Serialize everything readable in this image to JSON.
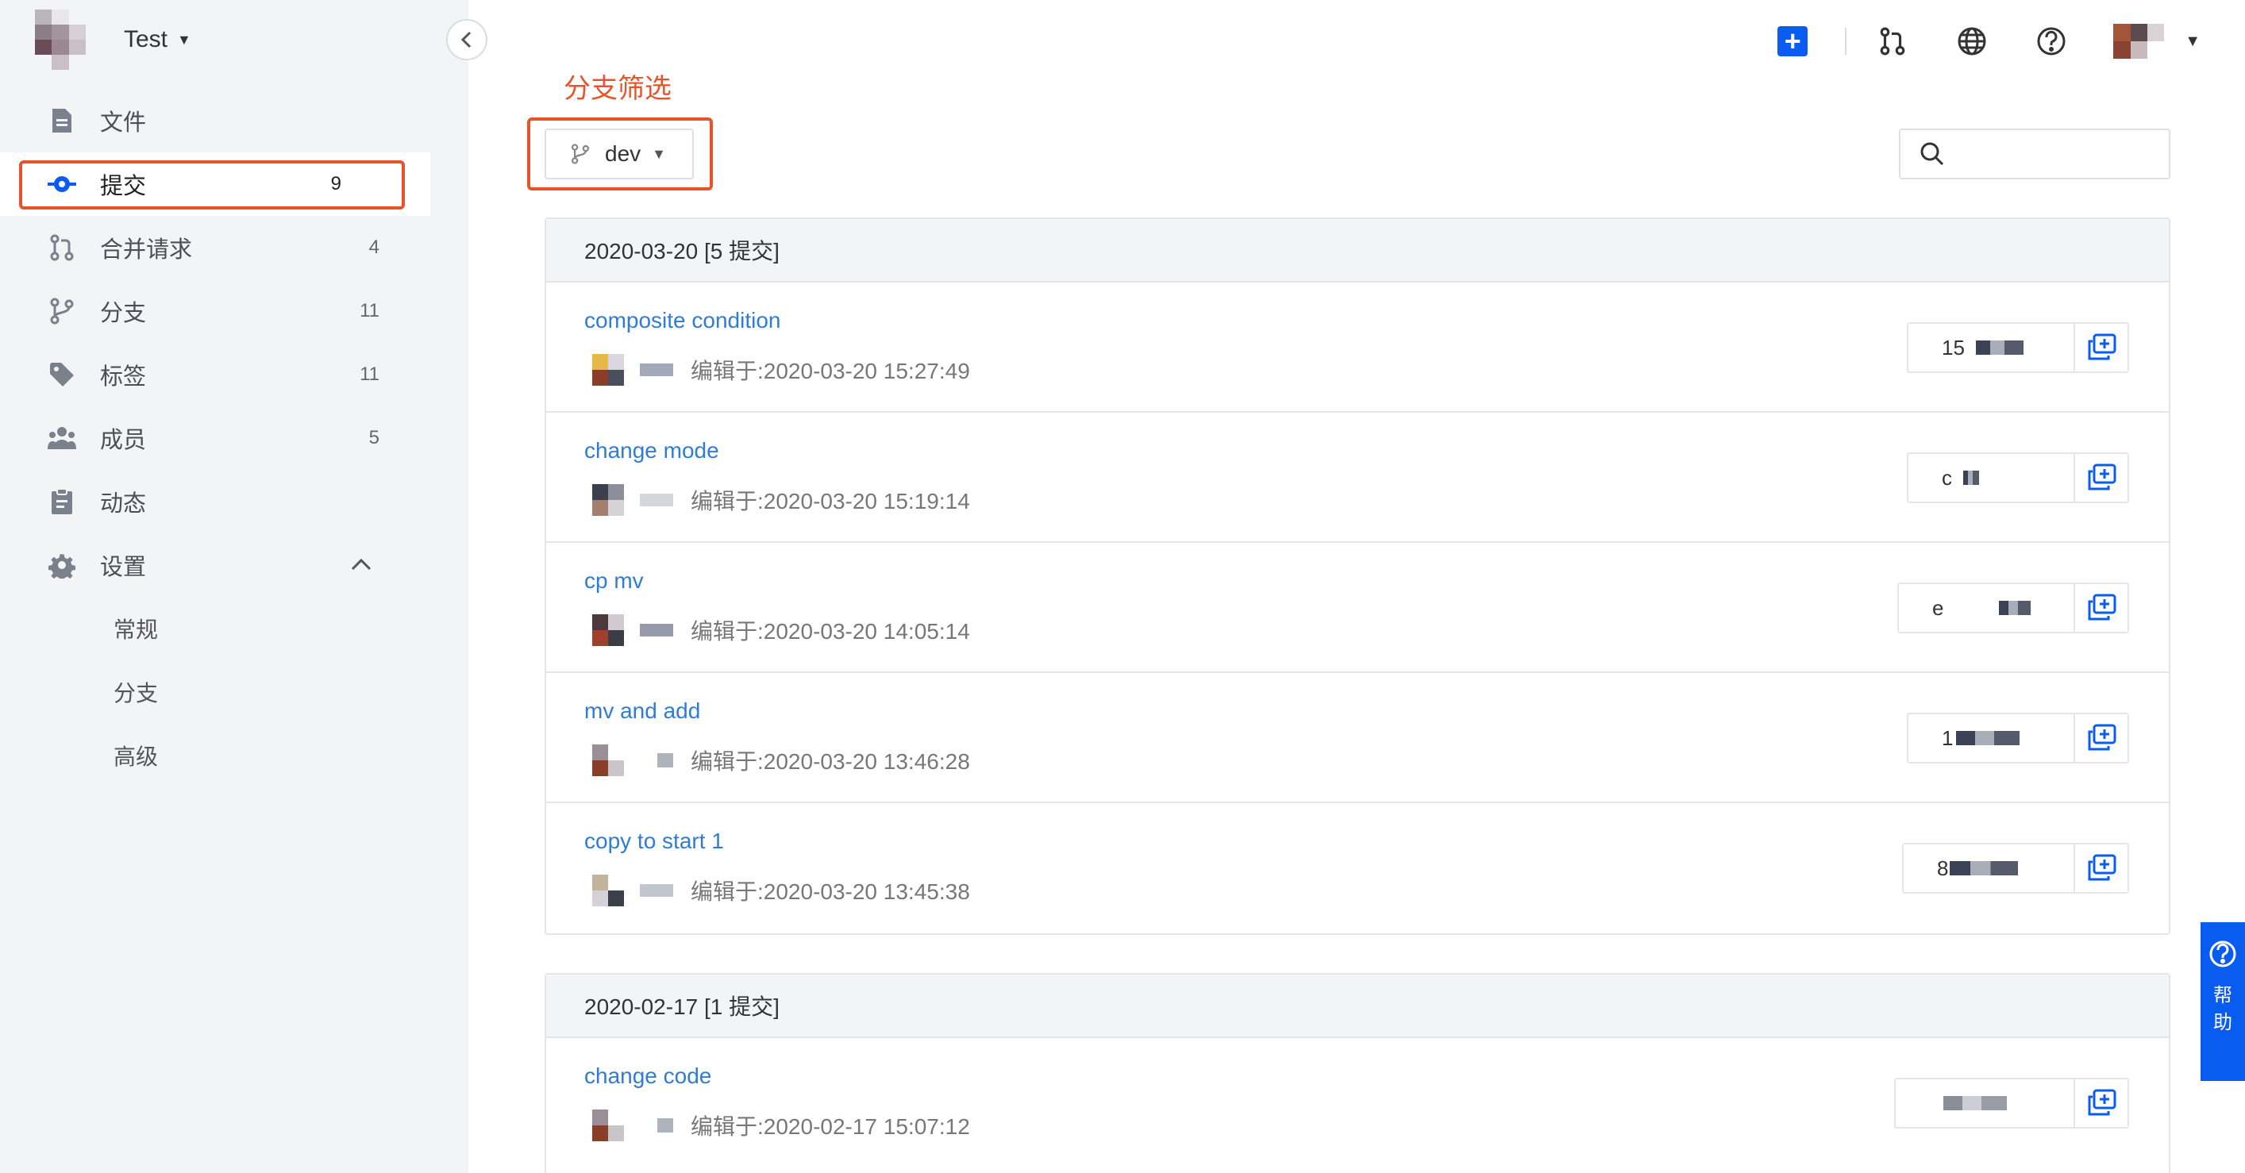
{
  "project": {
    "name": "Test"
  },
  "sidebar": {
    "items": [
      {
        "label": "文件",
        "count": ""
      },
      {
        "label": "提交",
        "count": "9"
      },
      {
        "label": "合并请求",
        "count": "4"
      },
      {
        "label": "分支",
        "count": "11"
      },
      {
        "label": "标签",
        "count": "11"
      },
      {
        "label": "成员",
        "count": "5"
      },
      {
        "label": "动态",
        "count": ""
      },
      {
        "label": "设置",
        "count": ""
      }
    ],
    "settings_sub": [
      "常规",
      "分支",
      "高级"
    ]
  },
  "annotation": {
    "filter_label": "分支筛选"
  },
  "filter": {
    "branch": "dev",
    "search_placeholder": ""
  },
  "groups": [
    {
      "header": "2020-03-20 [5 提交]",
      "commits": [
        {
          "title": "composite condition",
          "time": "编辑于:2020-03-20 15:27:49",
          "sha": "15"
        },
        {
          "title": "change mode",
          "time": "编辑于:2020-03-20 15:19:14",
          "sha": "c"
        },
        {
          "title": "cp mv",
          "time": "编辑于:2020-03-20 14:05:14",
          "sha": "e"
        },
        {
          "title": "mv and add",
          "time": "编辑于:2020-03-20 13:46:28",
          "sha": "1"
        },
        {
          "title": "copy to start 1",
          "time": "编辑于:2020-03-20 13:45:38",
          "sha": "8"
        }
      ]
    },
    {
      "header": "2020-02-17 [1 提交]",
      "commits": [
        {
          "title": "change code",
          "time": "编辑于:2020-02-17 15:07:12",
          "sha": ""
        }
      ]
    }
  ],
  "help": {
    "label": "帮助"
  },
  "colors": {
    "accent": "#0a5cf0",
    "link": "#2f7cd8",
    "highlight": "#e8542a"
  }
}
